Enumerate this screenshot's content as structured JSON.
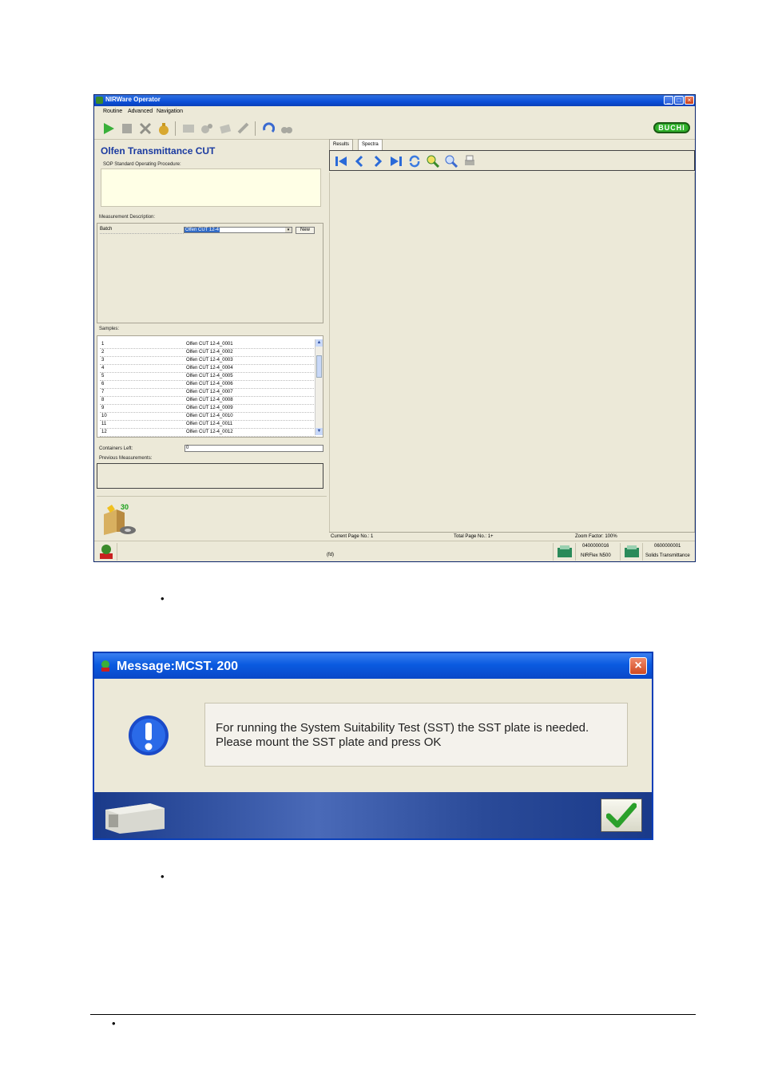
{
  "app": {
    "window_title": "NIRWare Operator",
    "menu": [
      "Routine",
      "Advanced",
      "Navigation"
    ],
    "brand": "BUCHI",
    "procedure_title": "Olfen Transmittance CUT",
    "sop_label": "SOP Standard Operating Procedure:",
    "measurement_description_label": "Measurement Description:",
    "batch_label": "Batch",
    "batch_value": "Olfen CUT 12-4",
    "new_button": "New",
    "samples_label": "Samples:",
    "samples": [
      {
        "n": "1",
        "name": "Olfen CUT 12-4_0001"
      },
      {
        "n": "2",
        "name": "Olfen CUT 12-4_0002"
      },
      {
        "n": "3",
        "name": "Olfen CUT 12-4_0003"
      },
      {
        "n": "4",
        "name": "Olfen CUT 12-4_0004"
      },
      {
        "n": "5",
        "name": "Olfen CUT 12-4_0005"
      },
      {
        "n": "6",
        "name": "Olfen CUT 12-4_0006"
      },
      {
        "n": "7",
        "name": "Olfen CUT 12-4_0007"
      },
      {
        "n": "8",
        "name": "Olfen CUT 12-4_0008"
      },
      {
        "n": "9",
        "name": "Olfen CUT 12-4_0009"
      },
      {
        "n": "10",
        "name": "Olfen CUT 12-4_0010"
      },
      {
        "n": "11",
        "name": "Olfen CUT 12-4_0011"
      },
      {
        "n": "12",
        "name": "Olfen CUT 12-4_0012"
      }
    ],
    "containers_left_label": "Containers Left:",
    "containers_left_value": "0",
    "previous_measurements_label": "Previous Measurements:",
    "counter": "30",
    "tabs": [
      "Results",
      "Spectra"
    ],
    "current_page": "Current Page No.: 1",
    "total_page": "Total Page No.: 1+",
    "zoom": "Zoom Factor: 100%",
    "status_center": "(fd)",
    "device1_id": "0400000016",
    "device1_name": "NIRFlex N500",
    "device2_id": "0600000001",
    "device2_name": "Solids Transmittance"
  },
  "dialog": {
    "title": "Message:MCST. 200",
    "line1": "For running the System Suitability Test (SST) the SST plate is needed.",
    "line2": "Please mount the SST plate and press OK"
  },
  "bullet_glyph": "•",
  "colors": {
    "title_blue": "#0a48c8",
    "accent_green": "#2fb02a",
    "procedure_blue": "#1a3aa0"
  }
}
